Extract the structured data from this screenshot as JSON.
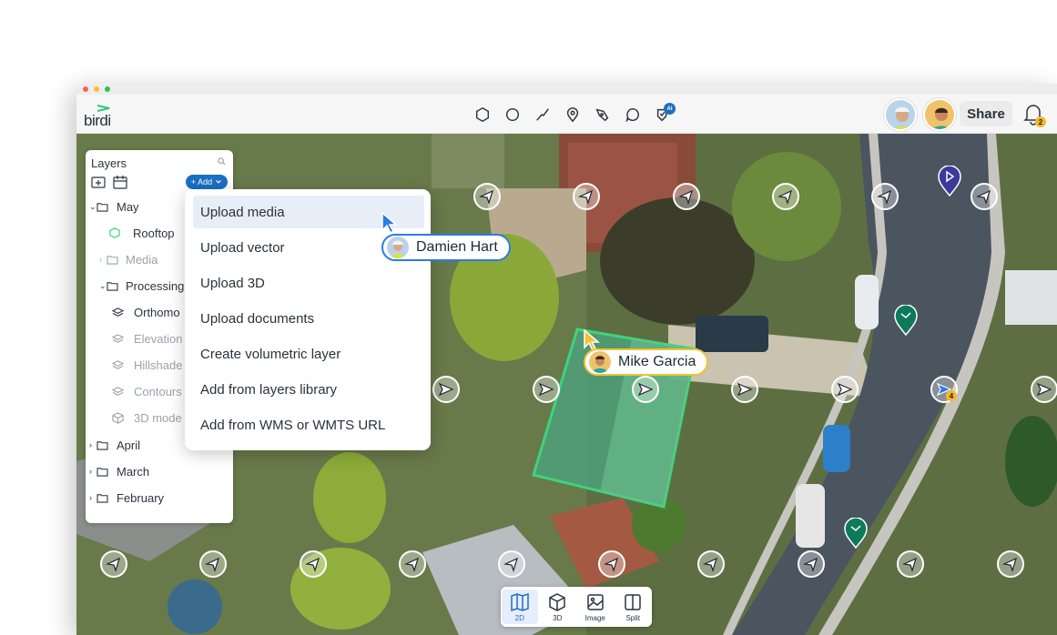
{
  "app": {
    "logo_text": "birdi"
  },
  "toolbar": {
    "tools": [
      "polygon-tool-icon",
      "circle-tool-icon",
      "line-tool-icon",
      "marker-tool-icon",
      "pen-tool-icon",
      "comment-tool-icon",
      "ai-tag-tool-icon"
    ],
    "ai_badge": "AI",
    "share_label": "Share",
    "notification_count": "2"
  },
  "layers": {
    "title": "Layers",
    "add_label": "+ Add",
    "tree": [
      {
        "label": "May",
        "dim": false
      },
      {
        "label": "Rooftop",
        "dim": false
      },
      {
        "label": "Media",
        "dim": true
      },
      {
        "label": "Processing",
        "dim": false
      },
      {
        "label": "Orthomo",
        "dim": false
      },
      {
        "label": "Elevation",
        "dim": true
      },
      {
        "label": "Hillshade",
        "dim": true
      },
      {
        "label": "Contours",
        "dim": true
      },
      {
        "label": "3D mode",
        "dim": true
      },
      {
        "label": "April",
        "dim": false
      },
      {
        "label": "March",
        "dim": false
      },
      {
        "label": "February",
        "dim": false
      }
    ]
  },
  "menu": {
    "items": [
      "Upload media",
      "Upload vector",
      "Upload 3D",
      "Upload documents",
      "Create volumetric layer",
      "Add from layers library",
      "Add from WMS or WMTS URL"
    ]
  },
  "collaborators": {
    "damien": "Damien Hart",
    "mike": "Mike Garcia"
  },
  "map": {
    "cluster_count": "4"
  },
  "viewbar": {
    "modes": [
      "2D",
      "3D",
      "Image",
      "Split"
    ],
    "active": "2D"
  },
  "colors": {
    "accent": "#1b6fc2",
    "damien_tag": "#2c7be5",
    "mike_tag": "#f2c230",
    "polygon": "#3fd37e"
  }
}
